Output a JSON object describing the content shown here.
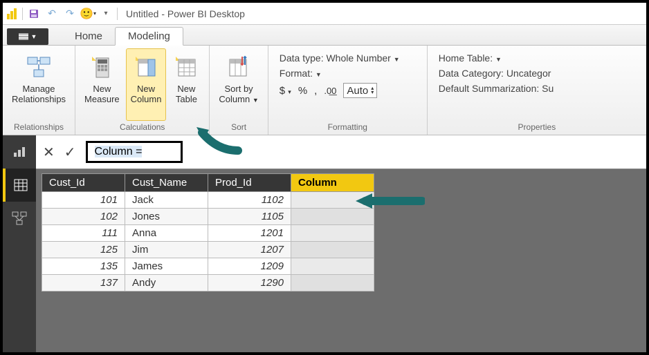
{
  "title": "Untitled - Power BI Desktop",
  "tabs": {
    "home": "Home",
    "modeling": "Modeling"
  },
  "ribbon": {
    "relationships": {
      "manage": "Manage\nRelationships",
      "group": "Relationships"
    },
    "calculations": {
      "newMeasure": "New\nMeasure",
      "newColumn": "New\nColumn",
      "newTable": "New\nTable",
      "group": "Calculations"
    },
    "sort": {
      "sortBy": "Sort by\nColumn",
      "group": "Sort"
    },
    "formatting": {
      "dataType": "Data type: Whole Number",
      "format": "Format:",
      "auto": "Auto",
      "group": "Formatting"
    },
    "properties": {
      "homeTable": "Home Table:",
      "dataCategory": "Data Category: Uncategor",
      "defaultSummarization": "Default Summarization: Su",
      "group": "Properties"
    }
  },
  "formula": "Column =",
  "table": {
    "headers": [
      "Cust_Id",
      "Cust_Name",
      "Prod_Id",
      "Column"
    ],
    "rows": [
      {
        "id": "101",
        "name": "Jack",
        "prod": "1102"
      },
      {
        "id": "102",
        "name": "Jones",
        "prod": "1105"
      },
      {
        "id": "111",
        "name": "Anna",
        "prod": "1201"
      },
      {
        "id": "125",
        "name": "Jim",
        "prod": "1207"
      },
      {
        "id": "135",
        "name": "James",
        "prod": "1209"
      },
      {
        "id": "137",
        "name": "Andy",
        "prod": "1290"
      }
    ]
  }
}
